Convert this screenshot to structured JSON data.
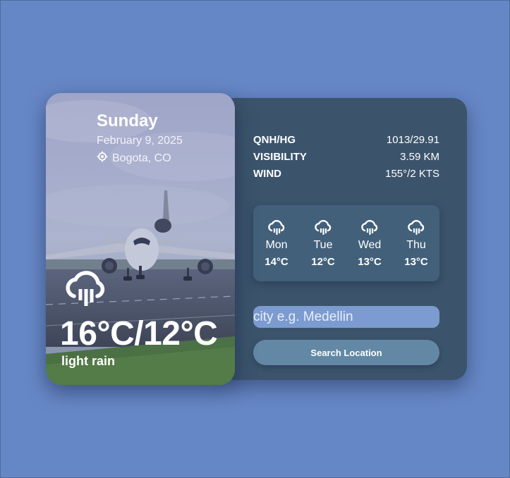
{
  "current": {
    "day": "Sunday",
    "date": "February 9, 2025",
    "location": "Bogota, CO",
    "temperature": "16°C/12°C",
    "description": "light rain",
    "icon": "cloud-rain-icon"
  },
  "stats": [
    {
      "label": "QNH/HG",
      "value": "1013/29.91"
    },
    {
      "label": "VISIBILITY",
      "value": "3.59 KM"
    },
    {
      "label": "WIND",
      "value": "155°/2 KTS"
    }
  ],
  "forecast": [
    {
      "day": "Mon",
      "temp": "14°C",
      "icon": "cloud-rain-icon"
    },
    {
      "day": "Tue",
      "temp": "12°C",
      "icon": "cloud-rain-icon"
    },
    {
      "day": "Wed",
      "temp": "13°C",
      "icon": "cloud-rain-icon"
    },
    {
      "day": "Thu",
      "temp": "13°C",
      "icon": "cloud-rain-icon"
    }
  ],
  "search": {
    "placeholder": "city e.g. Medellin",
    "button_label": "Search Location"
  },
  "colors": {
    "page_background": "#6687c6",
    "panel_background": "#3b546c",
    "input_background": "#7c9bd0",
    "button_background": "#6388a5"
  }
}
